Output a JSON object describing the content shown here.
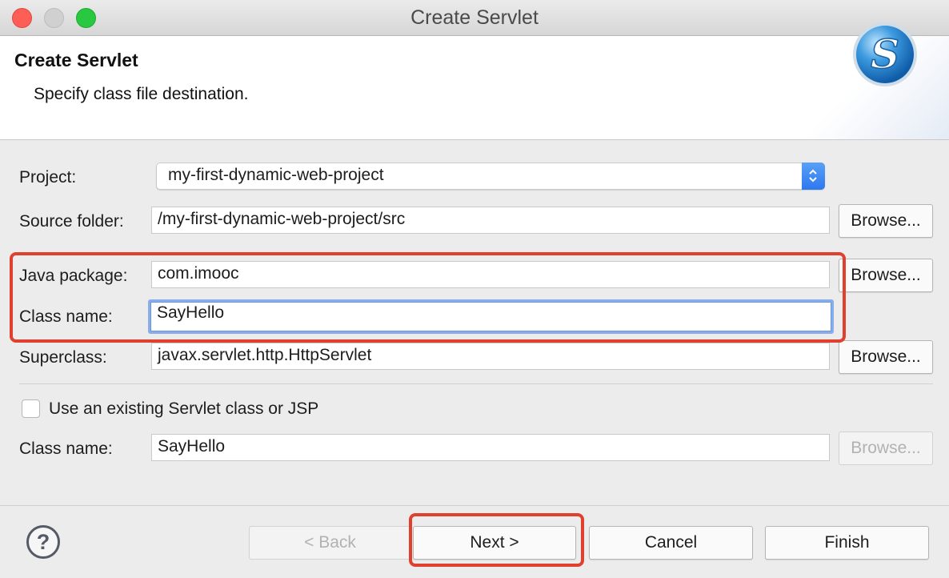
{
  "window": {
    "title": "Create Servlet"
  },
  "banner": {
    "title": "Create Servlet",
    "description": "Specify class file destination.",
    "logo_icon": "servlet-s-logo",
    "logo_letter": "S"
  },
  "form": {
    "project_label": "Project:",
    "project_value": "my-first-dynamic-web-project",
    "source_folder_label": "Source folder:",
    "source_folder_value": "/my-first-dynamic-web-project/src",
    "java_package_label": "Java package:",
    "java_package_value": "com.imooc",
    "class_name_label": "Class name:",
    "class_name_value": "SayHello",
    "superclass_label": "Superclass:",
    "superclass_value": "javax.servlet.http.HttpServlet",
    "existing_checkbox_label": "Use an existing Servlet class or JSP",
    "existing_checkbox_checked": false,
    "existing_class_name_label": "Class name:",
    "existing_class_name_value": "SayHello",
    "browse_label": "Browse..."
  },
  "footer": {
    "help_label": "?",
    "back_label": "< Back",
    "next_label": "Next >",
    "cancel_label": "Cancel",
    "finish_label": "Finish"
  },
  "colors": {
    "highlight": "#e0402e",
    "focus_ring": "#88aee9",
    "combo_accent": "#2d78ef"
  }
}
